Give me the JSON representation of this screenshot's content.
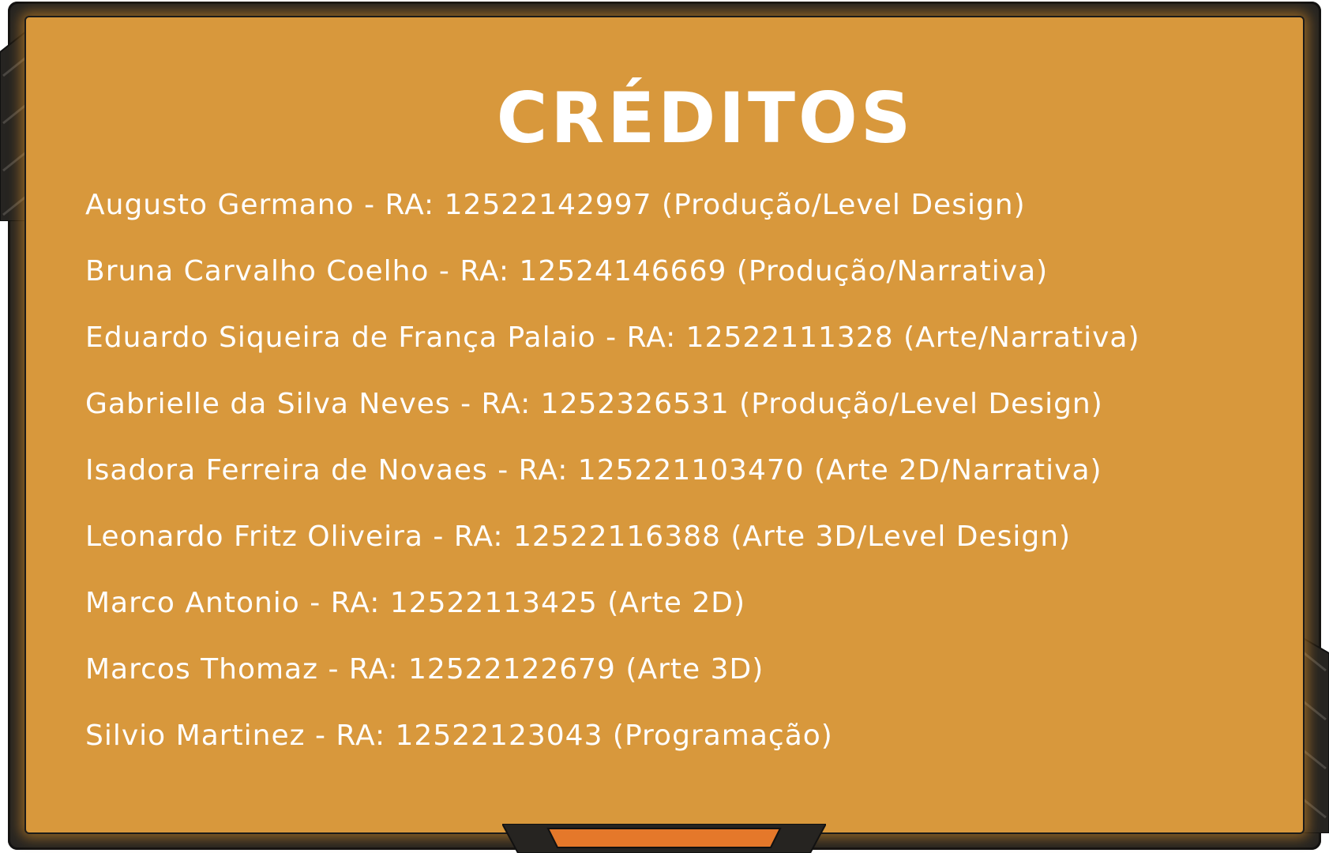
{
  "title": "CRÉDITOS",
  "credits": [
    "Augusto Germano - RA: 12522142997 (Produção/Level Design)",
    "Bruna Carvalho Coelho - RA: 12524146669 (Produção/Narrativa)",
    "Eduardo Siqueira de França Palaio - RA: 12522111328 (Arte/Narrativa)",
    "Gabrielle da Silva Neves - RA: 1252326531 (Produção/Level Design)",
    "Isadora Ferreira de Novaes - RA: 125221103470 (Arte 2D/Narrativa)",
    "Leonardo Fritz Oliveira - RA: 12522116388 (Arte 3D/Level Design)",
    "Marco Antonio - RA: 12522113425 (Arte 2D)",
    "Marcos Thomaz - RA: 12522122679 (Arte 3D)",
    "Silvio Martinez - RA: 12522123043 (Programação)"
  ],
  "colors": {
    "panel": "#d8983c",
    "frame": "#262421",
    "accent": "#e5782a",
    "text": "#ffffff"
  }
}
